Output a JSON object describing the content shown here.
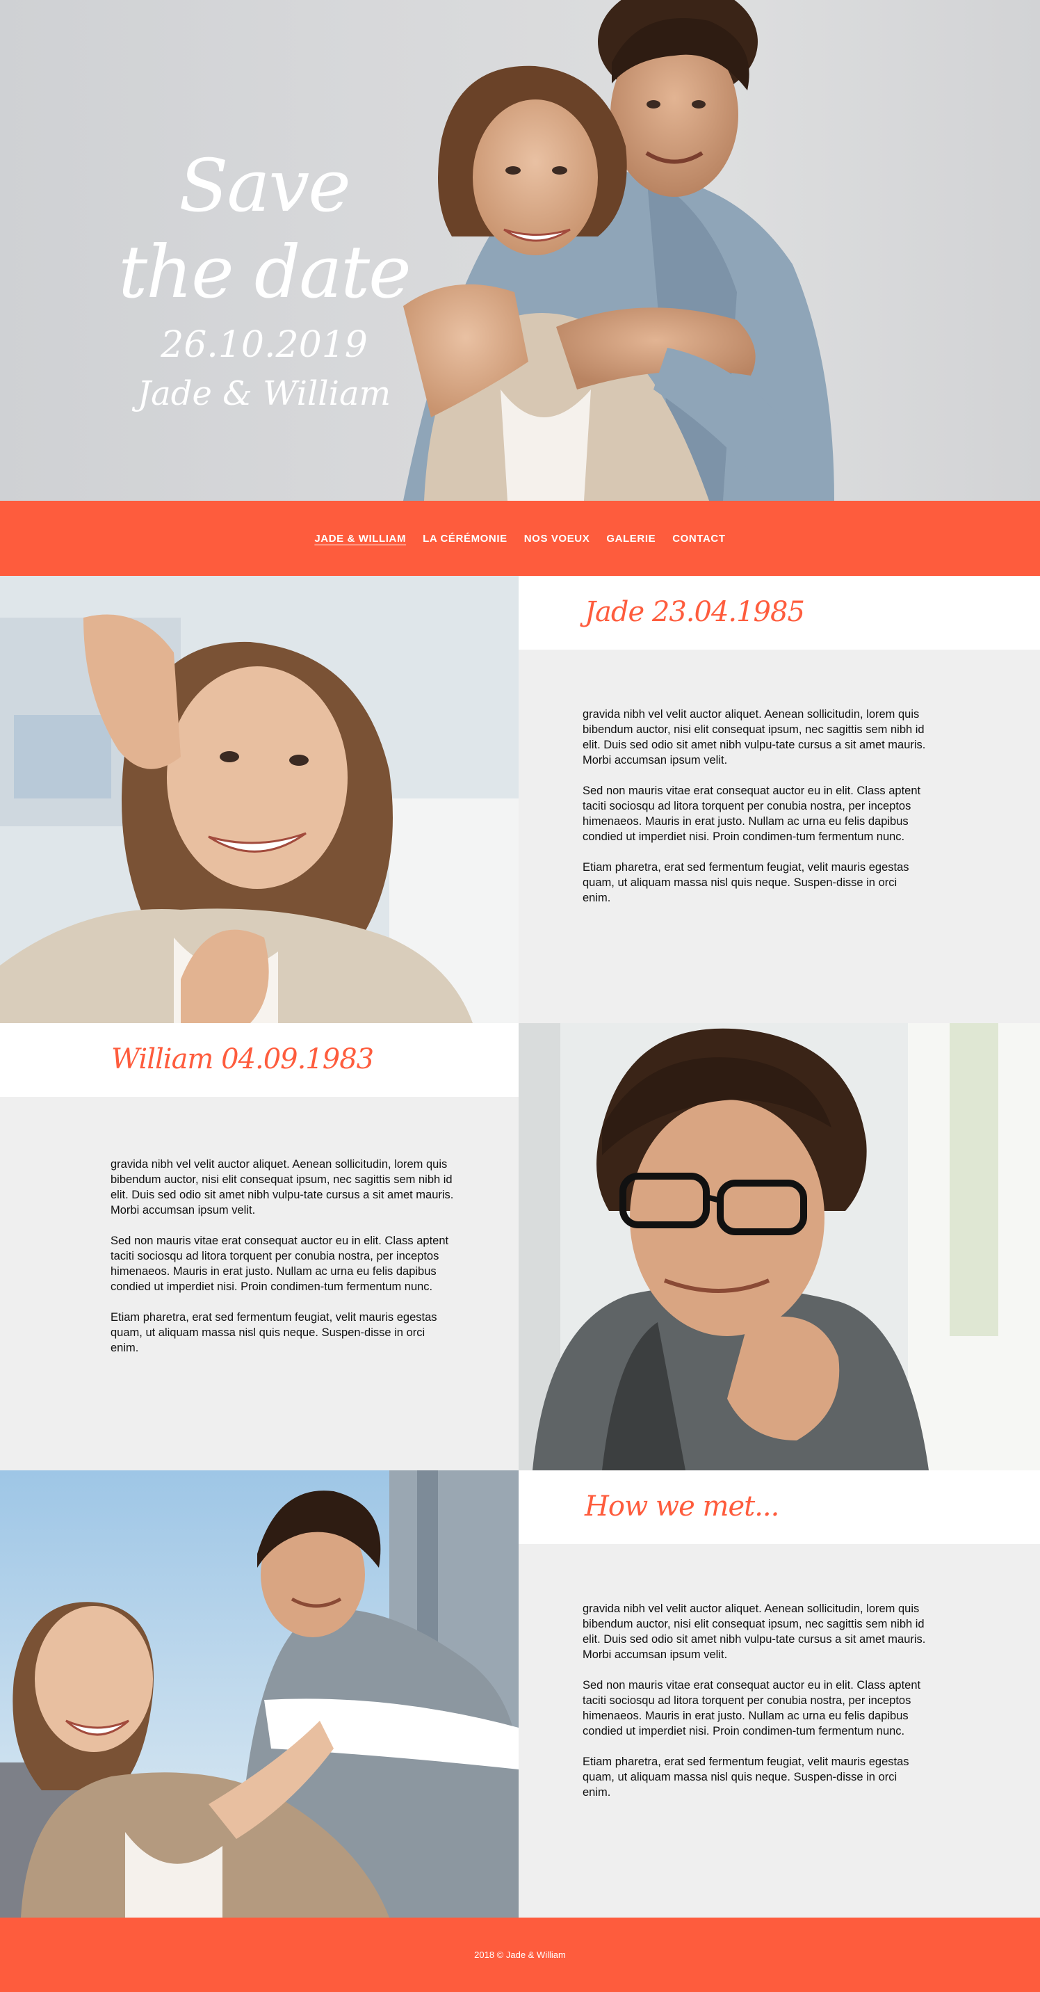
{
  "hero": {
    "title": "Save the date",
    "date": "26.10.2019",
    "names": "Jade & William"
  },
  "nav": {
    "items": [
      {
        "label": "JADE & WILLIAM",
        "active": true
      },
      {
        "label": "LA CÉRÉMONIE",
        "active": false
      },
      {
        "label": "NOS VOEUX",
        "active": false
      },
      {
        "label": "GALERIE",
        "active": false
      },
      {
        "label": "CONTACT",
        "active": false
      }
    ]
  },
  "sections": [
    {
      "heading": "Jade 23.04.1985",
      "paragraphs": [
        "gravida nibh vel velit auctor aliquet. Aenean sollicitudin, lorem quis bibendum auctor, nisi elit consequat ipsum, nec sagittis sem nibh id elit. Duis sed odio sit amet nibh vulpu-tate cursus a sit amet mauris. Morbi accumsan ipsum velit.",
        "Sed non  mauris vitae erat consequat auctor eu in elit. Class aptent taciti sociosqu ad litora torquent per conubia nostra, per inceptos himenaeos. Mauris in erat justo. Nullam ac urna eu felis dapibus condied ut imperdiet nisi. Proin condimen-tum fermentum nunc.",
        "Etiam pharetra, erat sed fermentum feugiat, velit mauris egestas quam, ut aliquam massa nisl quis neque. Suspen-disse in orci enim."
      ]
    },
    {
      "heading": "William 04.09.1983",
      "paragraphs": [
        "gravida nibh vel velit auctor aliquet. Aenean sollicitudin, lorem quis bibendum auctor, nisi elit consequat ipsum, nec sagittis sem nibh id elit. Duis sed odio sit amet nibh vulpu-tate cursus a sit amet mauris. Morbi accumsan ipsum velit.",
        "Sed non  mauris vitae erat consequat auctor eu in elit. Class aptent taciti sociosqu ad litora torquent per conubia nostra, per inceptos himenaeos. Mauris in erat justo. Nullam ac urna eu felis dapibus condied ut imperdiet nisi. Proin condimen-tum fermentum nunc.",
        "Etiam pharetra, erat sed fermentum feugiat, velit mauris egestas quam, ut aliquam massa nisl quis neque. Suspen-disse in orci enim."
      ]
    },
    {
      "heading": "How we met...",
      "paragraphs": [
        "gravida nibh vel velit auctor aliquet. Aenean sollicitudin, lorem quis bibendum auctor, nisi elit consequat ipsum, nec sagittis sem nibh id elit. Duis sed odio sit amet nibh vulpu-tate cursus a sit amet mauris. Morbi accumsan ipsum velit.",
        "Sed non  mauris vitae erat consequat auctor eu in elit. Class aptent taciti sociosqu ad litora torquent per conubia nostra, per inceptos himenaeos. Mauris in erat justo. Nullam ac urna eu felis dapibus condied ut imperdiet nisi. Proin condimen-tum fermentum nunc.",
        "Etiam pharetra, erat sed fermentum feugiat, velit mauris egestas quam, ut aliquam massa nisl quis neque. Suspen-disse in orci enim."
      ]
    }
  ],
  "footer": {
    "copyright": "2018 © Jade & William"
  },
  "colors": {
    "accent": "#fe5c3d",
    "panel": "#efefef"
  }
}
